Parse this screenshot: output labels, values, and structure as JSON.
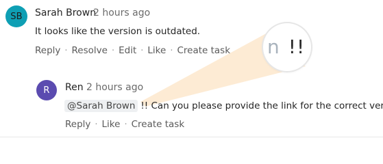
{
  "comments": [
    {
      "avatar_initials": "SB",
      "author": "Sarah Brown",
      "time": "2 hours ago",
      "text": "It looks like the version is outdated.",
      "actions": [
        "Reply",
        "Resolve",
        "Edit",
        "Like",
        "Create task"
      ]
    },
    {
      "avatar_initials": "R",
      "author": "Ren",
      "time": "2 hours ago",
      "mention": "@Sarah Brown",
      "text": "!! Can you please provide the link for the correct version?",
      "actions": [
        "Reply",
        "Like",
        "Create task"
      ]
    }
  ],
  "magnifier": {
    "faded_glyph": "n",
    "text": "!! C"
  },
  "colors": {
    "avatar_sb": "#0e9fb4",
    "avatar_r": "#5b4bb0",
    "highlight_beam": "#fde9cf",
    "mention_bg": "#eef0f2"
  }
}
